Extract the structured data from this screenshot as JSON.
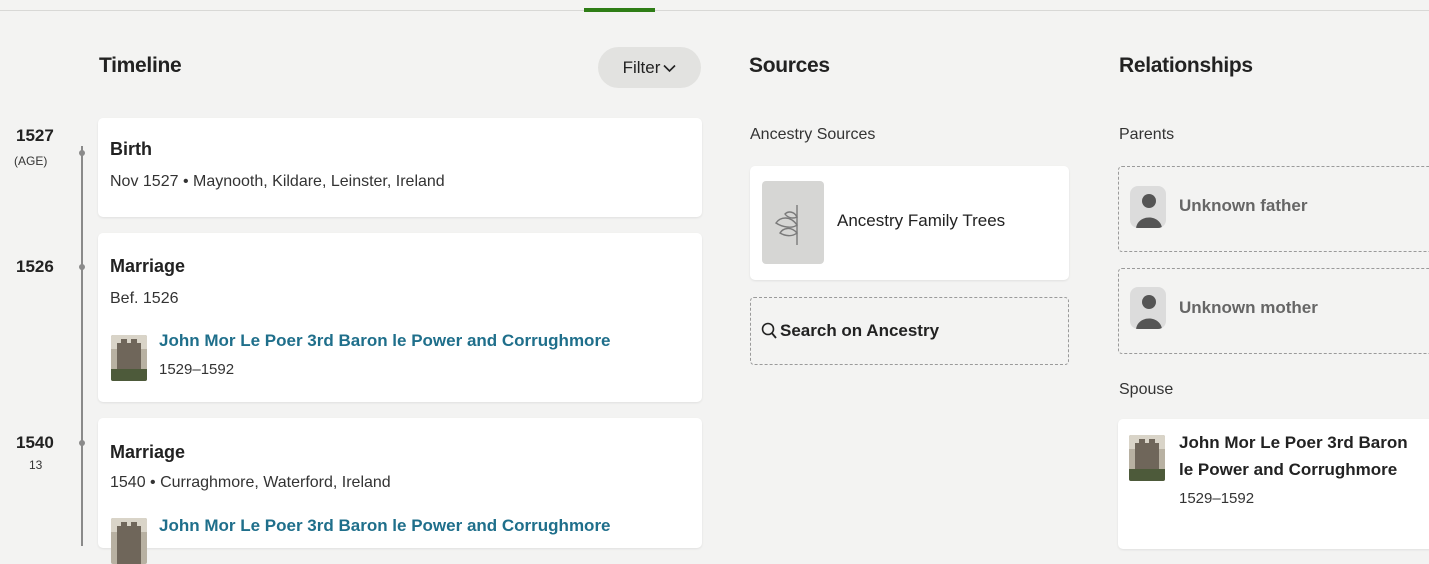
{
  "timeline": {
    "title": "Timeline",
    "filter_label": "Filter",
    "events": [
      {
        "year": "1527",
        "age": "(AGE)",
        "title": "Birth",
        "detail": "Nov 1527 • Maynooth, Kildare, Leinster, Ireland"
      },
      {
        "year": "1526",
        "title": "Marriage",
        "detail": "Bef. 1526",
        "person": {
          "name": "John Mor Le Poer 3rd Baron le Power and Corrughmore",
          "dates": "1529–1592"
        }
      },
      {
        "year": "1540",
        "age": "13",
        "title": "Marriage",
        "detail": "1540 • Curraghmore, Waterford, Ireland",
        "person": {
          "name": "John Mor Le Poer 3rd Baron le Power and Corrughmore"
        }
      }
    ]
  },
  "sources": {
    "title": "Sources",
    "subtitle": "Ancestry Sources",
    "items": [
      {
        "label": "Ancestry Family Trees",
        "icon": "leaf-icon"
      }
    ],
    "search_label": "Search on Ancestry"
  },
  "relationships": {
    "title": "Relationships",
    "parents_label": "Parents",
    "father": "Unknown father",
    "mother": "Unknown mother",
    "spouse_label": "Spouse",
    "spouse": {
      "name_line1": "John Mor Le Poer 3rd Baron",
      "name_line2": "le Power and Corrughmore",
      "dates": "1529–1592"
    }
  },
  "colors": {
    "link": "#1f6f8b",
    "accent": "#2e7d16",
    "background": "#f3f3f2"
  }
}
